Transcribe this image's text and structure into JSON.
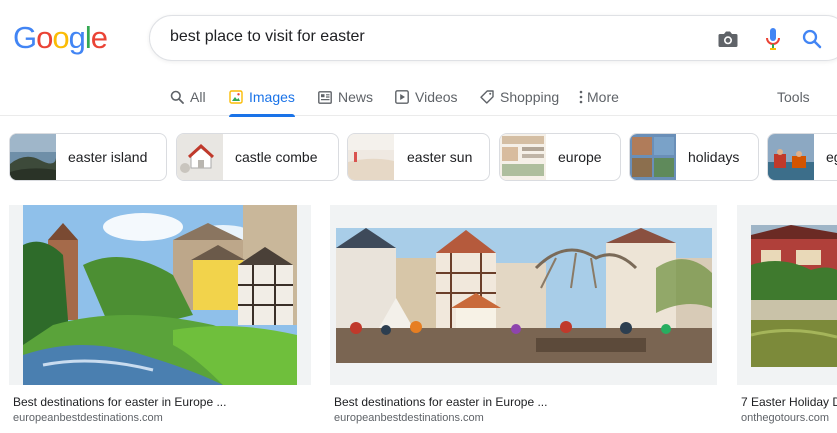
{
  "logo": {
    "letters": [
      "G",
      "o",
      "o",
      "g",
      "l",
      "e"
    ],
    "colors": [
      "#4285F4",
      "#EA4335",
      "#FBBC05",
      "#4285F4",
      "#34A853",
      "#EA4335"
    ]
  },
  "search": {
    "query": "best place to visit for easter"
  },
  "icons": {
    "camera": "camera-icon",
    "mic": "microphone-icon",
    "search": "search-icon"
  },
  "tabs": [
    {
      "label": "All",
      "icon": "search-icon"
    },
    {
      "label": "Images",
      "icon": "image-icon",
      "active": true
    },
    {
      "label": "News",
      "icon": "news-icon"
    },
    {
      "label": "Videos",
      "icon": "play-icon"
    },
    {
      "label": "Shopping",
      "icon": "tag-icon"
    },
    {
      "label": "More",
      "icon": "more-vert-icon"
    }
  ],
  "tools_label": "Tools",
  "chips": [
    {
      "label": "easter island"
    },
    {
      "label": "castle combe"
    },
    {
      "label": "easter sun"
    },
    {
      "label": "europe"
    },
    {
      "label": "holidays"
    },
    {
      "label": "eg"
    }
  ],
  "results": [
    {
      "title": "Best destinations for easter in Europe ...",
      "site": "europeanbestdestinations.com"
    },
    {
      "title": "Best destinations for easter in Europe ...",
      "site": "europeanbestdestinations.com"
    },
    {
      "title": "7 Easter Holiday D",
      "site": "onthegotours.com"
    }
  ],
  "colors": {
    "accent": "#1a73e8",
    "muted": "#5f6368",
    "border": "#dadce0"
  }
}
